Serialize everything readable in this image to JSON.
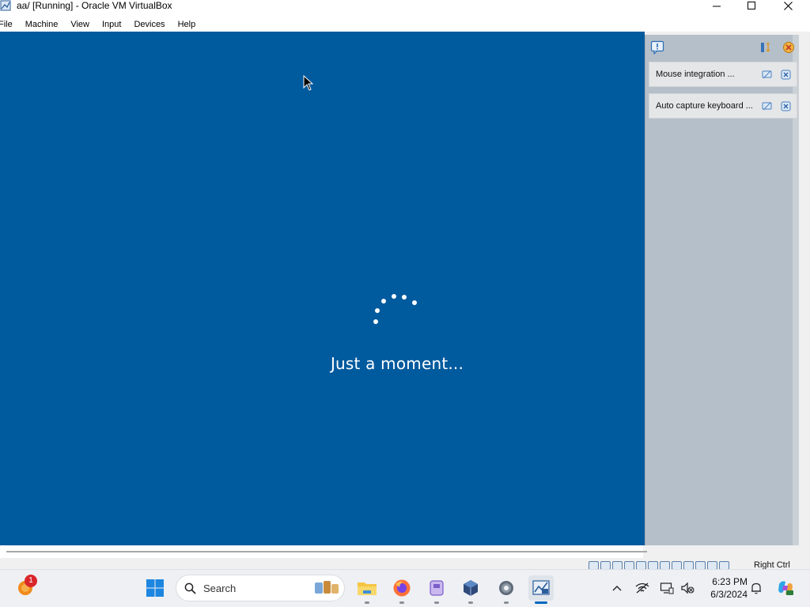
{
  "window": {
    "title": "aa/ [Running] - Oracle VM VirtualBox",
    "icon": "virtualbox-icon",
    "controls": [
      "minimize-icon",
      "maximize-icon",
      "close-icon"
    ]
  },
  "menubar": {
    "items": [
      "File",
      "Machine",
      "View",
      "Input",
      "Devices",
      "Help"
    ]
  },
  "vm_screen": {
    "background": "#005a9e",
    "status_text": "Just a moment...",
    "spinner": "loading-spinner"
  },
  "notification_panel": {
    "header_icon": "notification-center-icon",
    "header_buttons": [
      "sort-icon",
      "dismiss-all-icon"
    ],
    "items": [
      {
        "text": "Mouse integration ...",
        "icons": [
          "suppress-icon",
          "close-icon"
        ]
      },
      {
        "text": "Auto capture keyboard ...",
        "icons": [
          "suppress-icon",
          "close-icon"
        ]
      }
    ]
  },
  "statusbar": {
    "host_key": "Right Ctrl"
  },
  "taskbar": {
    "search_placeholder": "Search",
    "notification_badge": "1",
    "apps": [
      "start-icon",
      "search-icon",
      "file-explorer-icon",
      "firefox-icon",
      "app-icon",
      "virtualbox-icon",
      "settings-icon",
      "vm-window-icon"
    ],
    "tray": [
      "chevron-up-icon",
      "network-icon",
      "display-icon",
      "volume-muted-icon",
      "bell-icon",
      "copilot-icon"
    ],
    "time": "6:23 PM",
    "date": "6/3/2024"
  },
  "colors": {
    "vm_blue": "#005a9e",
    "panel_gray": "#b5bfc9",
    "taskbar": "#eef0f4",
    "accent": "#0067c0"
  }
}
